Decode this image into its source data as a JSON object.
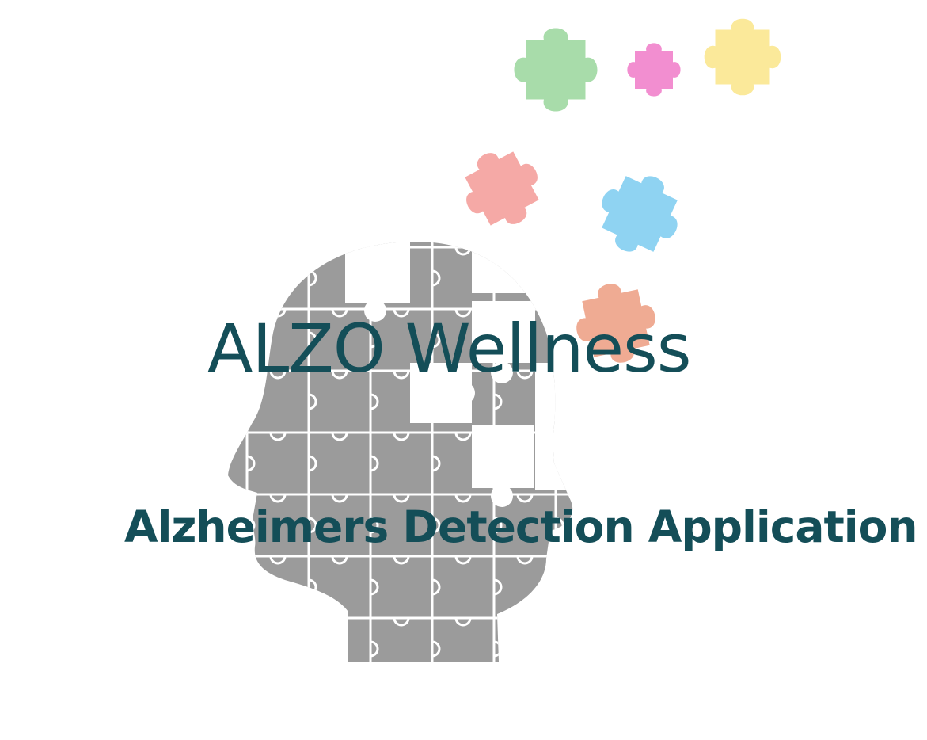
{
  "splash": {
    "title": "ALZO Wellness",
    "subtitle": "Alzheimers Detection Application",
    "logo": {
      "icon": "head-puzzle-icon",
      "head_color": "#9b9b9b",
      "pieces": [
        {
          "icon": "puzzle-piece-icon",
          "color": "#a8dcaa"
        },
        {
          "icon": "puzzle-piece-icon",
          "color": "#f28ed0"
        },
        {
          "icon": "puzzle-piece-icon",
          "color": "#fbe99a"
        },
        {
          "icon": "puzzle-piece-icon",
          "color": "#f5a9a6"
        },
        {
          "icon": "puzzle-piece-icon",
          "color": "#8fd3f2"
        },
        {
          "icon": "puzzle-piece-icon",
          "color": "#efab93"
        }
      ]
    }
  },
  "colors": {
    "text": "#144e58",
    "background": "#ffffff"
  }
}
